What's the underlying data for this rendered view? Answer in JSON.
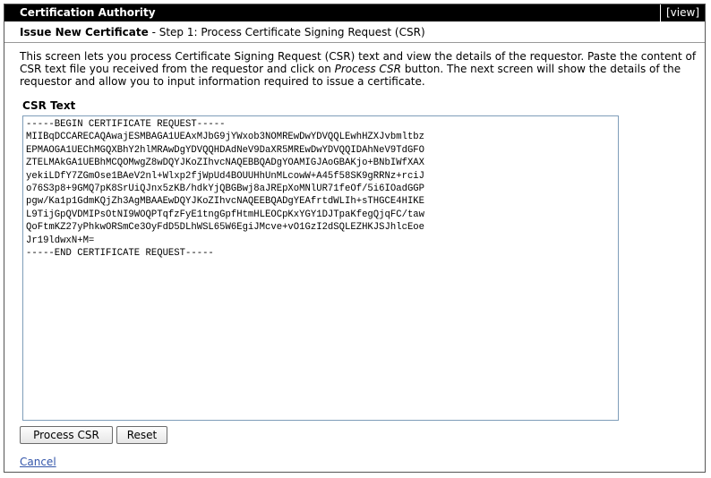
{
  "window": {
    "title": "Certification Authority",
    "view_label": "[view]"
  },
  "subheader": {
    "title": "Issue New Certificate",
    "step": " - Step 1: Process Certificate Signing Request (CSR)"
  },
  "description": {
    "part1": "This screen lets you process Certificate Signing Request (CSR) text and view the details of the requestor. Paste the content of CSR text file you received from the requestor and click on ",
    "emphasis": "Process CSR",
    "part2": " button. The next screen will show the details of the requestor and allow you to input information required to issue a certificate."
  },
  "csr": {
    "label": "CSR Text",
    "value": "-----BEGIN CERTIFICATE REQUEST-----\nMIIBqDCCARECAQAwajESMBAGA1UEAxMJbG9jYWxob3NOMREwDwYDVQQLEwhHZXJvbmltbz\nEPMAOGA1UEChMGQXBhY2hlMRAwDgYDVQQHDAdNeV9DaXR5MREwDwYDVQQIDAhNeV9TdGFO\nZTELMAkGA1UEBhMCQOMwgZ8wDQYJKoZIhvcNAQEBBQADgYOAMIGJAoGBAKjo+BNbIWfXAX\nyekiLDfY7ZGmOse1BAeV2nl+Wlxp2fjWpUd4BOUUHhUnMLcowW+A45f58SK9gRRNz+rciJ\no76S3p8+9GMQ7pK8SrUiQJnx5zKB/hdkYjQBGBwj8aJREpXoMNlUR71feOf/5i6IOadGGP\npgw/Ka1p1GdmKQjZh3AgMBAAEwDQYJKoZIhvcNAQEEBQADgYEAfrtdWLIh+sTHGCE4HIKE\nL9TijGpQVDMIPsOtNI9WOQPTqfzFyE1tngGpfHtmHLEOCpKxYGY1DJTpaKfegQjqFC/taw\nQoFtmKZ27yPhkwORSmCe3OyFdD5DLhWSL65W6EgiJMcve+vO1GzI2dSQLEZHKJSJhlcEoe\nJr19ldwxN+M=\n-----END CERTIFICATE REQUEST-----"
  },
  "buttons": {
    "process_label": "Process CSR",
    "reset_label": "Reset"
  },
  "cancel_label": "Cancel"
}
